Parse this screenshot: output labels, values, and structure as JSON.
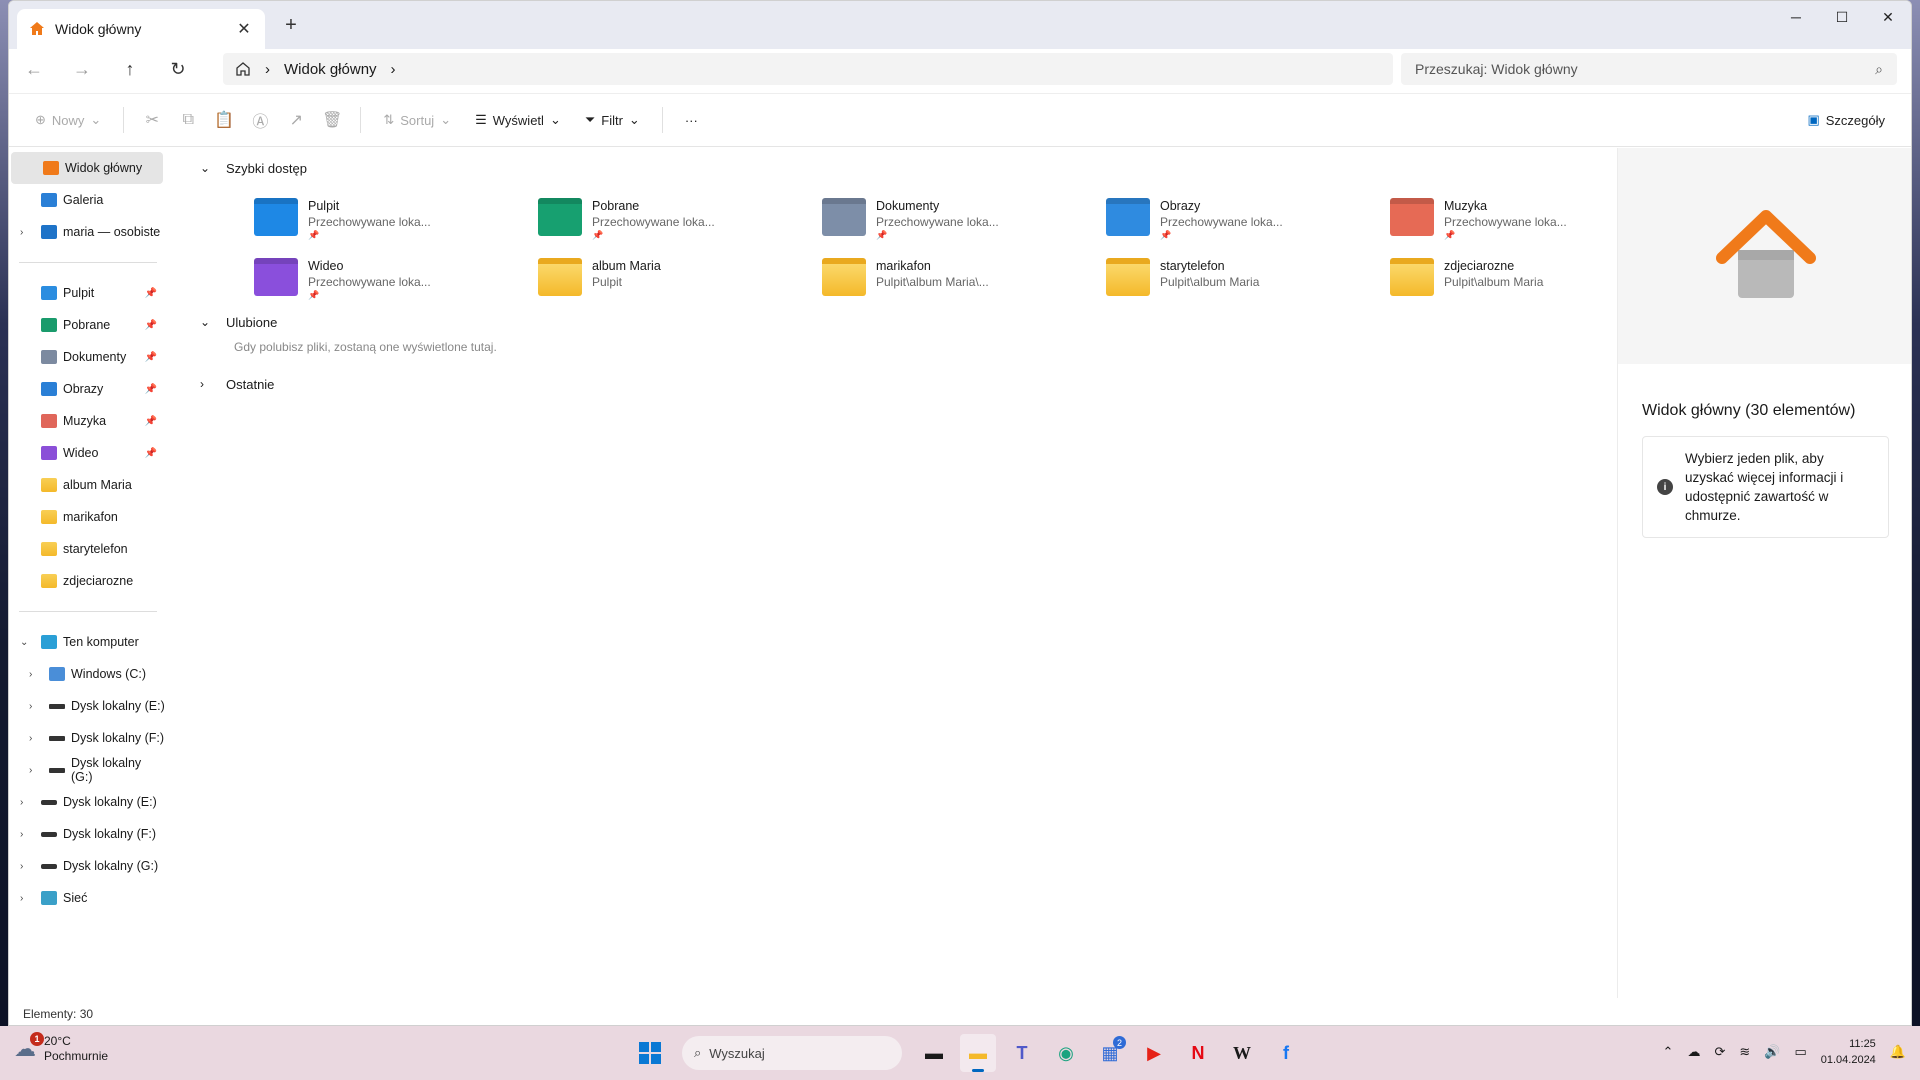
{
  "window": {
    "tab_title": "Widok główny",
    "tab_close": "✕",
    "new_tab": "+",
    "controls": {
      "minimize": "─",
      "maximize": "☐",
      "close": "✕"
    }
  },
  "address": {
    "breadcrumb": "Widok główny",
    "search_placeholder": "Przeszukaj: Widok główny"
  },
  "commandbar": {
    "new": "Nowy",
    "sort": "Sortuj",
    "view": "Wyświetl",
    "filter": "Filtr",
    "more": "···",
    "details": "Szczegóły"
  },
  "sidebar": {
    "top": [
      {
        "label": "Widok główny",
        "icon": "home-icon"
      },
      {
        "label": "Galeria",
        "icon": "gallery-icon"
      },
      {
        "label": "maria — osobiste",
        "icon": "cloud-icon"
      }
    ],
    "pinned": [
      {
        "label": "Pulpit",
        "icon": "desktop-icon",
        "color": "#2b8de0"
      },
      {
        "label": "Pobrane",
        "icon": "download-icon",
        "color": "#1a9b6c"
      },
      {
        "label": "Dokumenty",
        "icon": "documents-icon",
        "color": "#7c8aa0"
      },
      {
        "label": "Obrazy",
        "icon": "pictures-icon",
        "color": "#2a7fd6"
      },
      {
        "label": "Muzyka",
        "icon": "music-icon",
        "color": "#e0665a"
      },
      {
        "label": "Wideo",
        "icon": "video-icon",
        "color": "#8b4fd8"
      },
      {
        "label": "album Maria",
        "icon": "folder-icon"
      },
      {
        "label": "marikafon",
        "icon": "folder-icon"
      },
      {
        "label": "starytelefon",
        "icon": "folder-icon"
      },
      {
        "label": "zdjeciarozne",
        "icon": "folder-icon"
      }
    ],
    "computer": "Ten komputer",
    "drives_nested": [
      "Windows (C:)",
      "Dysk lokalny (E:)",
      "Dysk lokalny (F:)",
      "Dysk lokalny (G:)"
    ],
    "drives": [
      "Dysk lokalny (E:)",
      "Dysk lokalny (F:)",
      "Dysk lokalny (G:)"
    ],
    "network": "Sieć"
  },
  "main": {
    "quick_access": "Szybki dostęp",
    "items": [
      {
        "name": "Pulpit",
        "sub": "Przechowywane loka...",
        "pinned": true,
        "icon": "desktop-folder-icon",
        "color": "#1e88e5"
      },
      {
        "name": "Pobrane",
        "sub": "Przechowywane loka...",
        "pinned": true,
        "icon": "downloads-folder-icon",
        "color": "#17a070"
      },
      {
        "name": "Dokumenty",
        "sub": "Przechowywane loka...",
        "pinned": true,
        "icon": "documents-folder-icon",
        "color": "#7d8ea8"
      },
      {
        "name": "Obrazy",
        "sub": "Przechowywane loka...",
        "pinned": true,
        "icon": "pictures-folder-icon",
        "color": "#2f8be0"
      },
      {
        "name": "Muzyka",
        "sub": "Przechowywane loka...",
        "pinned": true,
        "icon": "music-folder-icon",
        "color": "#e66a55"
      },
      {
        "name": "Wideo",
        "sub": "Przechowywane loka...",
        "pinned": true,
        "icon": "video-folder-icon",
        "color": "#8a4fdc"
      },
      {
        "name": "album Maria",
        "sub": "Pulpit",
        "pinned": false,
        "icon": "folder-icon",
        "color": "#f6c443"
      },
      {
        "name": "marikafon",
        "sub": "Pulpit\\album Maria\\...",
        "pinned": false,
        "icon": "folder-icon",
        "color": "#f6c443"
      },
      {
        "name": "starytelefon",
        "sub": "Pulpit\\album Maria",
        "pinned": false,
        "icon": "folder-icon",
        "color": "#f6c443"
      },
      {
        "name": "zdjeciarozne",
        "sub": "Pulpit\\album Maria",
        "pinned": false,
        "icon": "folder-icon",
        "color": "#f6c443"
      }
    ],
    "favorites": "Ulubione",
    "favorites_hint": "Gdy polubisz pliki, zostaną one wyświetlone tutaj.",
    "recent": "Ostatnie"
  },
  "details_pane": {
    "title": "Widok główny (30 elementów)",
    "info": "Wybierz jeden plik, aby uzyskać więcej informacji i udostępnić zawartość w chmurze."
  },
  "status": "Elementy: 30",
  "taskbar": {
    "weather_temp": "20°C",
    "weather_desc": "Pochmurnie",
    "weather_badge": "1",
    "search_label": "Wyszukaj",
    "store_badge": "2",
    "time": "11:25",
    "date": "01.04.2024"
  },
  "colors": {
    "accent": "#0067c0",
    "folder": "#f6c443",
    "home_orange": "#f07a1a"
  }
}
